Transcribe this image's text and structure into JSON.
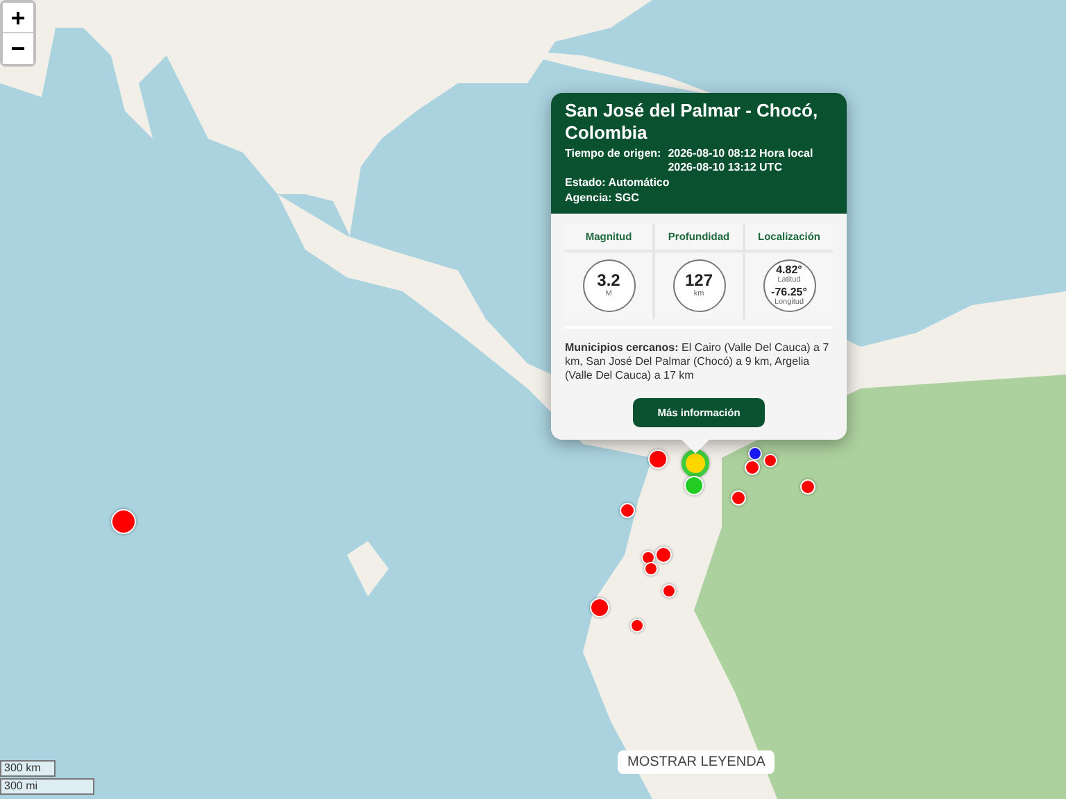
{
  "zoom_controls": [
    {
      "label": "+"
    },
    {
      "label": "−"
    }
  ],
  "popup": {
    "title": "San José del Palmar - Chocó, Colombia",
    "origin_label": "Tiempo de origen:",
    "origin_local": "2026-08-10 08:12 Hora local",
    "origin_utc": "2026-08-10 13:12 UTC",
    "status": "Estado: Automático",
    "agency": "Agencia: SGC",
    "stats": [
      {
        "heading": "Magnitud",
        "kind": "single",
        "value": "3.2",
        "unit": "M"
      },
      {
        "heading": "Profundidad",
        "kind": "single",
        "value": "127",
        "unit": "km"
      },
      {
        "heading": "Localización",
        "kind": "double",
        "value": "4.82°",
        "unit": "Latitud",
        "value2": "-76.25°",
        "unit2": "Longitud"
      }
    ],
    "nearby_label": "Municipios cercanos:",
    "nearby_text": "El Cairo (Valle Del Cauca) a 7 km, San José Del Palmar (Chocó) a 9 km, Argelia (Valle Del Cauca) a 17 km",
    "button": "Más información"
  },
  "markers": [
    {
      "color": "#ff0000",
      "selected": false
    },
    {
      "color": "#ff0000",
      "selected": false
    },
    {
      "color": "#ffd700",
      "selected": true
    },
    {
      "color": "#22cc22",
      "selected": false
    },
    {
      "color": "#1a1aff",
      "selected": false
    },
    {
      "color": "#ff0000",
      "selected": false
    },
    {
      "color": "#ff0000",
      "selected": false
    },
    {
      "color": "#ff0000",
      "selected": false
    },
    {
      "color": "#ff0000",
      "selected": false
    },
    {
      "color": "#ff0000",
      "selected": false
    },
    {
      "color": "#ff0000",
      "selected": false
    },
    {
      "color": "#ff0000",
      "selected": false
    },
    {
      "color": "#ff0000",
      "selected": false
    },
    {
      "color": "#ff0000",
      "selected": false
    },
    {
      "color": "#ff0000",
      "selected": false
    },
    {
      "color": "#ff0000",
      "selected": false
    }
  ],
  "scale": {
    "metric": "300 km",
    "imperial": "300 mi"
  },
  "legend_button": "MOSTRAR LEYENDA"
}
